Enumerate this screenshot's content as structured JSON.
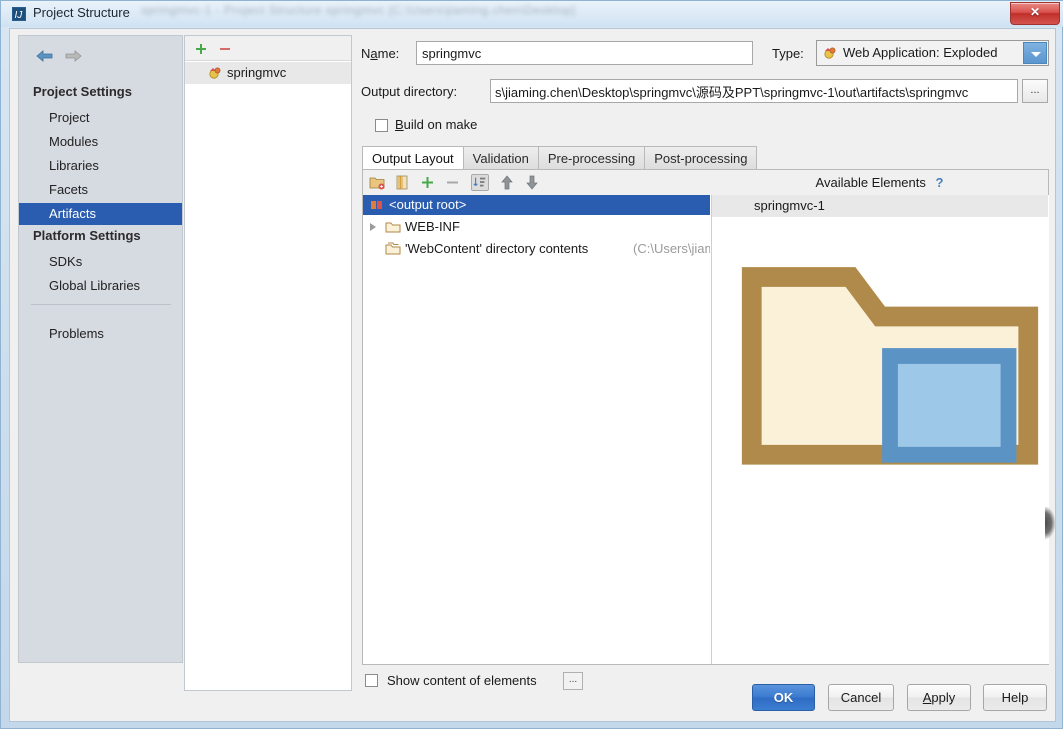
{
  "window": {
    "title": "Project Structure",
    "title_icon": "intellij-idea-icon",
    "title_blur_text": "springmvc-1 - Project Structure springmvc [C:\\Users\\jiaming.chen\\Desktop]",
    "close_label": "✕"
  },
  "sidebar": {
    "back_icon": "back-arrow-icon",
    "forward_icon": "forward-arrow-icon",
    "groups": [
      {
        "label": "Project Settings",
        "items": [
          {
            "label": "Project",
            "selected": false
          },
          {
            "label": "Modules",
            "selected": false
          },
          {
            "label": "Libraries",
            "selected": false
          },
          {
            "label": "Facets",
            "selected": false
          },
          {
            "label": "Artifacts",
            "selected": true
          }
        ]
      },
      {
        "label": "Platform Settings",
        "items": [
          {
            "label": "SDKs",
            "selected": false
          },
          {
            "label": "Global Libraries",
            "selected": false
          }
        ]
      }
    ],
    "problems": {
      "label": "Problems",
      "selected": false
    }
  },
  "artifact_list": {
    "add_icon": "plus-icon",
    "remove_icon": "minus-icon",
    "items": [
      {
        "label": "springmvc",
        "icon": "artifact-icon",
        "selected": true
      }
    ]
  },
  "editor": {
    "name_label": "Name:",
    "name_value": "springmvc",
    "type_label": "Type:",
    "type_value": "Web Application: Exploded",
    "type_icon": "artifact-icon",
    "output_dir_label": "Output directory:",
    "output_dir_value": "s\\jiaming.chen\\Desktop\\springmvc\\源码及PPT\\springmvc-1\\out\\artifacts\\springmvc",
    "output_dir_browse_label": "...",
    "build_on_make_label": "Build on make",
    "build_on_make_checked": false,
    "tabs": [
      {
        "label": "Output Layout",
        "active": true
      },
      {
        "label": "Validation",
        "active": false
      },
      {
        "label": "Pre-processing",
        "active": false
      },
      {
        "label": "Post-processing",
        "active": false
      }
    ],
    "toolbar": [
      {
        "icon": "add-directory-icon",
        "pressed": false
      },
      {
        "icon": "add-archive-icon",
        "pressed": false
      },
      {
        "icon": "plus-icon",
        "pressed": false
      },
      {
        "icon": "minus-icon",
        "pressed": false
      },
      {
        "icon": "sort-icon",
        "pressed": true
      },
      {
        "icon": "move-up-icon",
        "pressed": false
      },
      {
        "icon": "move-down-icon",
        "pressed": false
      }
    ],
    "available_elements_label": "Available Elements",
    "available_elements_help": "?",
    "output_tree": [
      {
        "label": "<output root>",
        "sub": "",
        "icon": "artifact-root-icon",
        "selected": true,
        "indent": 0,
        "expandable": false
      },
      {
        "label": "WEB-INF",
        "sub": "",
        "icon": "folder-icon",
        "selected": false,
        "indent": 1,
        "expandable": true
      },
      {
        "label": "'WebContent' directory contents",
        "sub": "(C:\\Users\\jiaming",
        "icon": "directory-contents-icon",
        "selected": false,
        "indent": 1,
        "expandable": false
      }
    ],
    "available_tree": [
      {
        "label": "springmvc-1",
        "icon": "module-icon",
        "selected": false
      }
    ],
    "show_content_label": "Show content of elements",
    "show_content_checked": false,
    "show_content_ellipsis": "..."
  },
  "footer": {
    "buttons": [
      {
        "label": "OK",
        "default": true
      },
      {
        "label": "Cancel",
        "default": false
      },
      {
        "label": "Apply",
        "default": false,
        "mnemonic": "A"
      },
      {
        "label": "Help",
        "default": false
      }
    ]
  },
  "colors": {
    "selection_blue": "#2a5db0",
    "default_button_blue": "#3a7ad0",
    "sidebar_bg": "#d6dae1",
    "close_red": "#d9514c"
  }
}
